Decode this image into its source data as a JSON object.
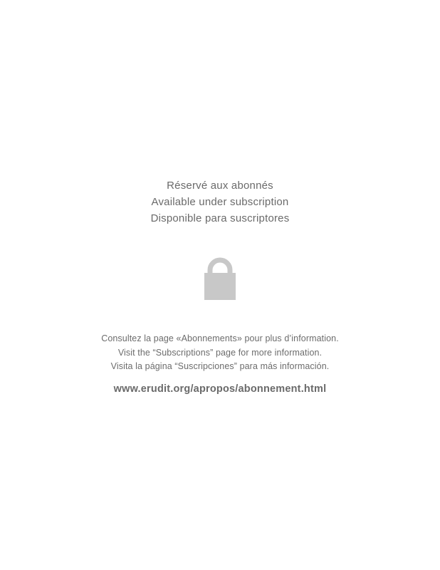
{
  "notice": {
    "lines": [
      "Réservé aux abonnés",
      "Available under subscription",
      "Disponible para suscriptores"
    ]
  },
  "lock": {
    "icon": "lock-icon",
    "color": "#c8c8c8"
  },
  "info": {
    "lines": [
      "Consultez la page «Abonnements» pour plus d’information.",
      "Visit the “Subscriptions” page for more information.",
      "Visita la página “Suscripciones” para más información."
    ]
  },
  "link": {
    "text": "www.erudit.org/apropos/abonnement.html"
  }
}
